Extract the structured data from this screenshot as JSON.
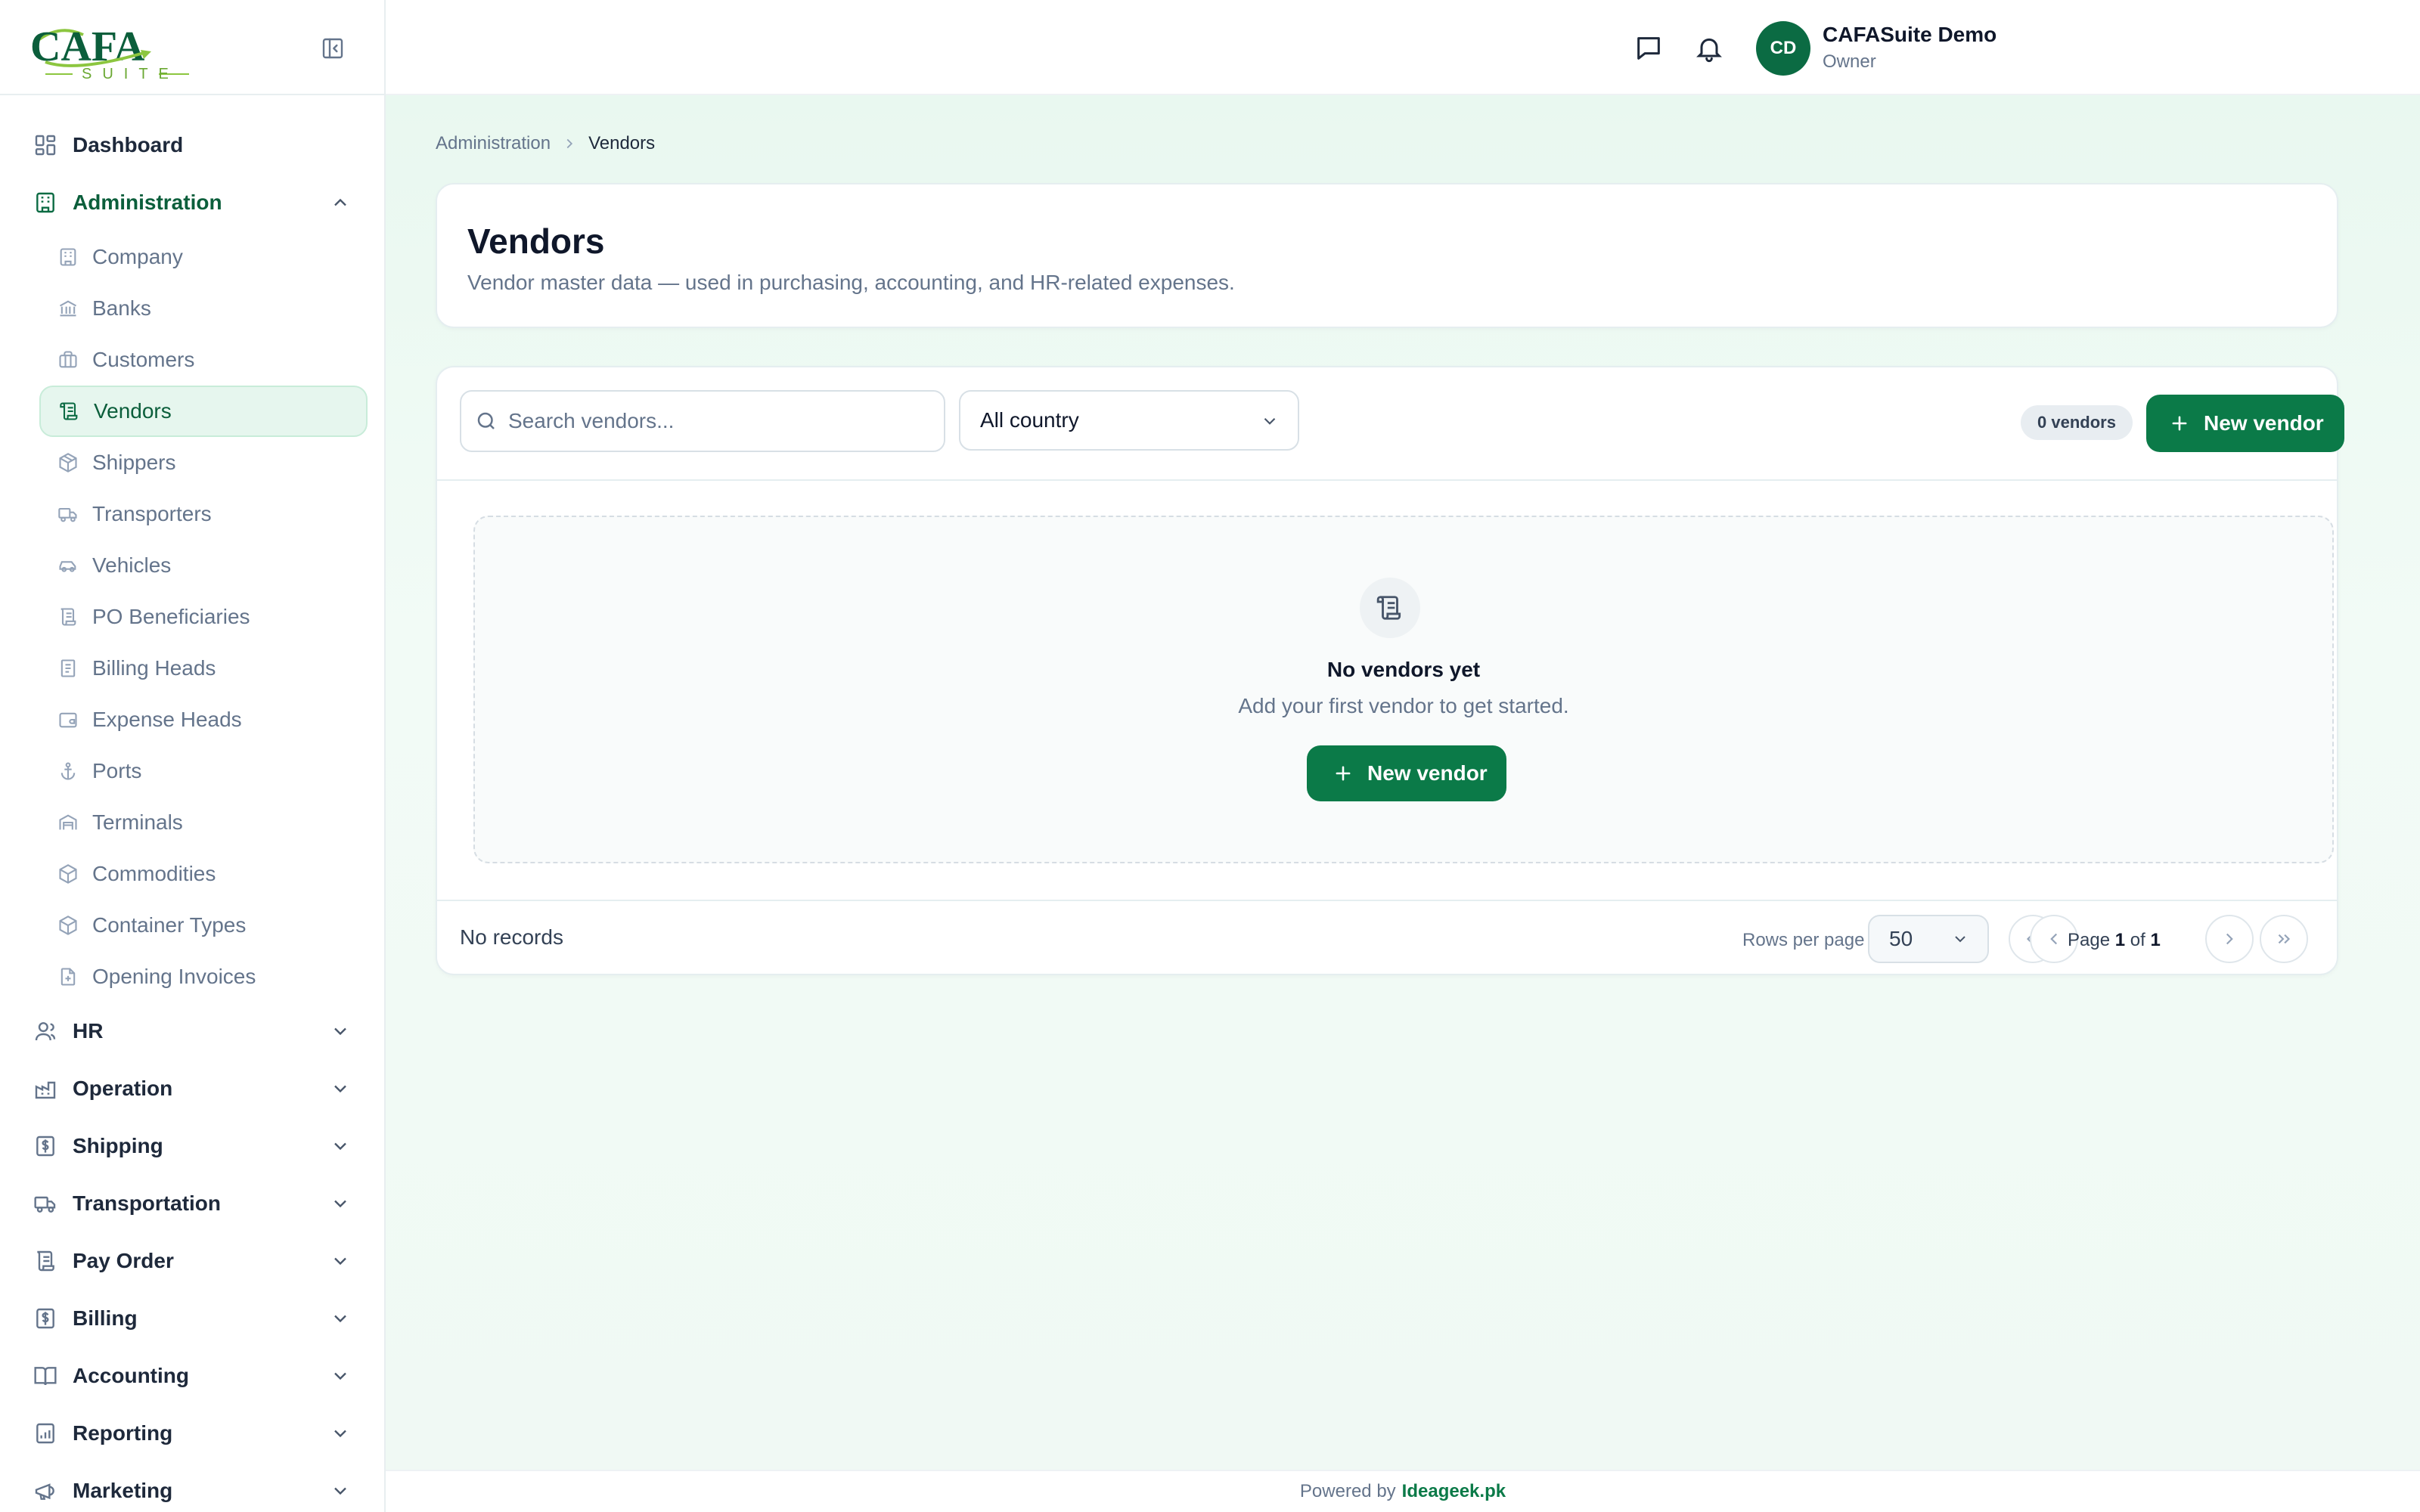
{
  "brand": {
    "logo_text": "CAFA",
    "logo_sub": "SUITE",
    "accent": "#0b7a48",
    "accent_light": "#8cc63f"
  },
  "sidebar": {
    "dashboard": {
      "label": "Dashboard",
      "icon": "dashboard-icon"
    },
    "administration": {
      "label": "Administration",
      "icon": "building-icon",
      "items": [
        {
          "label": "Company",
          "icon": "building-icon"
        },
        {
          "label": "Banks",
          "icon": "bank-icon"
        },
        {
          "label": "Customers",
          "icon": "briefcase-icon"
        },
        {
          "label": "Vendors",
          "icon": "scroll-icon",
          "active": true
        },
        {
          "label": "Shippers",
          "icon": "package-icon"
        },
        {
          "label": "Transporters",
          "icon": "truck-icon"
        },
        {
          "label": "Vehicles",
          "icon": "car-icon"
        },
        {
          "label": "PO Beneficiaries",
          "icon": "scroll-icon"
        },
        {
          "label": "Billing Heads",
          "icon": "receipt-icon"
        },
        {
          "label": "Expense Heads",
          "icon": "wallet-icon"
        },
        {
          "label": "Ports",
          "icon": "anchor-icon"
        },
        {
          "label": "Terminals",
          "icon": "warehouse-icon"
        },
        {
          "label": "Commodities",
          "icon": "box-icon"
        },
        {
          "label": "Container Types",
          "icon": "box-icon"
        },
        {
          "label": "Opening Invoices",
          "icon": "file-plus-icon"
        }
      ]
    },
    "groups": [
      {
        "label": "HR",
        "icon": "users-icon"
      },
      {
        "label": "Operation",
        "icon": "factory-icon"
      },
      {
        "label": "Shipping",
        "icon": "dollar-doc-icon"
      },
      {
        "label": "Transportation",
        "icon": "truck-icon"
      },
      {
        "label": "Pay Order",
        "icon": "scroll-icon"
      },
      {
        "label": "Billing",
        "icon": "dollar-doc-icon"
      },
      {
        "label": "Accounting",
        "icon": "book-icon"
      },
      {
        "label": "Reporting",
        "icon": "chart-icon"
      },
      {
        "label": "Marketing",
        "icon": "megaphone-icon"
      }
    ]
  },
  "header": {
    "user": {
      "initials": "CD",
      "name": "CAFASuite Demo",
      "role": "Owner"
    }
  },
  "breadcrumb": {
    "parent": "Administration",
    "current": "Vendors"
  },
  "page": {
    "title": "Vendors",
    "subtitle": "Vendor master data — used in purchasing, accounting, and HR-related expenses."
  },
  "toolbar": {
    "search_placeholder": "Search vendors...",
    "country_filter": "All country",
    "count_badge": "0 vendors",
    "new_button": "New vendor"
  },
  "empty_state": {
    "title": "No vendors yet",
    "subtitle": "Add your first vendor to get started.",
    "button": "New vendor"
  },
  "table_footer": {
    "records": "No records",
    "rows_per_page_label": "Rows per page",
    "rows_per_page": "50",
    "page_word": "Page",
    "page_current": "1",
    "page_of": "of",
    "page_total": "1"
  },
  "footer": {
    "powered_by": "Powered by",
    "link": "Ideageek.pk"
  }
}
